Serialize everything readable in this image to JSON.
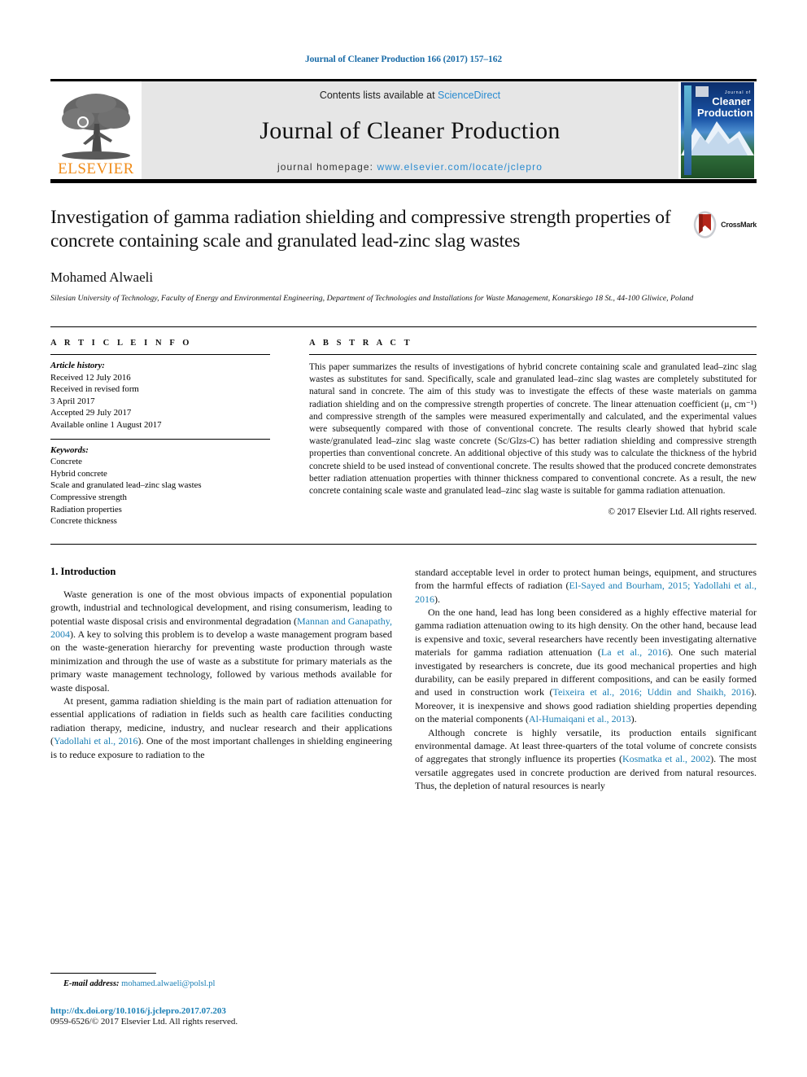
{
  "running_head": "Journal of Cleaner Production 166 (2017) 157–162",
  "masthead": {
    "publisher_name": "ELSEVIER",
    "contents_prefix": "Contents lists available at ",
    "contents_link": "ScienceDirect",
    "journal_name": "Journal of Cleaner Production",
    "homepage_prefix": "journal homepage: ",
    "homepage_url": "www.elsevier.com/locate/jclepro",
    "cover": {
      "line1": "Journal of",
      "line2": "Cleaner",
      "line3": "Production"
    }
  },
  "article": {
    "title": "Investigation of gamma radiation shielding and compressive strength properties of concrete containing scale and granulated lead-zinc slag wastes",
    "crossmark_label": "CrossMark",
    "author": "Mohamed Alwaeli",
    "affiliation": "Silesian University of Technology, Faculty of Energy and Environmental Engineering, Department of Technologies and Installations for Waste Management, Konarskiego 18 St., 44-100 Gliwice, Poland"
  },
  "article_info": {
    "heading": "A R T I C L E   I N F O",
    "history_label": "Article history:",
    "history_lines": [
      "Received 12 July 2016",
      "Received in revised form",
      "3 April 2017",
      "Accepted 29 July 2017",
      "Available online 1 August 2017"
    ],
    "keywords_label": "Keywords:",
    "keywords": [
      "Concrete",
      "Hybrid concrete",
      "Scale and granulated lead–zinc slag wastes",
      "Compressive strength",
      "Radiation properties",
      "Concrete thickness"
    ]
  },
  "abstract": {
    "heading": "A B S T R A C T",
    "text": "This paper summarizes the results of investigations of hybrid concrete containing scale and granulated lead–zinc slag wastes as substitutes for sand. Specifically, scale and granulated lead–zinc slag wastes are completely substituted for natural sand in concrete. The aim of this study was to investigate the effects of these waste materials on gamma radiation shielding and on the compressive strength properties of concrete. The linear attenuation coefficient (μ, cm⁻¹) and compressive strength of the samples were measured experimentally and calculated, and the experimental values were subsequently compared with those of conventional concrete. The results clearly showed that hybrid scale waste/granulated lead–zinc slag waste concrete (Sc/Glzs-C) has better radiation shielding and compressive strength properties than conventional concrete. An additional objective of this study was to calculate the thickness of the hybrid concrete shield to be used instead of conventional concrete. The results showed that the produced concrete demonstrates better radiation attenuation properties with thinner thickness compared to conventional concrete. As a result, the new concrete containing scale waste and granulated lead–zinc slag waste is suitable for gamma radiation attenuation.",
    "copyright": "© 2017 Elsevier Ltd. All rights reserved."
  },
  "body": {
    "section_title": "1. Introduction",
    "left_column": [
      {
        "segments": [
          {
            "t": "Waste generation is one of the most obvious impacts of exponential population growth, industrial and technological development, and rising consumerism, leading to potential waste disposal crisis and environmental degradation (",
            "c": false
          },
          {
            "t": "Mannan and Ganapathy, 2004",
            "c": true
          },
          {
            "t": "). A key to solving this problem is to develop a waste management program based on the waste-generation hierarchy for preventing waste production through waste minimization and through the use of waste as a substitute for primary materials as the primary waste management technology, followed by various methods available for waste disposal.",
            "c": false
          }
        ]
      },
      {
        "segments": [
          {
            "t": "At present, gamma radiation shielding is the main part of radiation attenuation for essential applications of radiation in fields such as health care facilities conducting radiation therapy, medicine, industry, and nuclear research and their applications (",
            "c": false
          },
          {
            "t": "Yadollahi et al., 2016",
            "c": true
          },
          {
            "t": "). One of the most important challenges in shielding engineering is to reduce exposure to radiation to the",
            "c": false
          }
        ]
      }
    ],
    "right_column": [
      {
        "segments": [
          {
            "t": "standard acceptable level in order to protect human beings, equipment, and structures from the harmful effects of radiation (",
            "c": false
          },
          {
            "t": "El-Sayed and Bourham, 2015; Yadollahi et al., 2016",
            "c": true
          },
          {
            "t": ").",
            "c": false
          }
        ],
        "noindent": true
      },
      {
        "segments": [
          {
            "t": "On the one hand, lead has long been considered as a highly effective material for gamma radiation attenuation owing to its high density. On the other hand, because lead is expensive and toxic, several researchers have recently been investigating alternative materials for gamma radiation attenuation (",
            "c": false
          },
          {
            "t": "La et al., 2016",
            "c": true
          },
          {
            "t": "). One such material investigated by researchers is concrete, due its good mechanical properties and high durability, can be easily prepared in different compositions, and can be easily formed and used in construction work (",
            "c": false
          },
          {
            "t": "Teixeira et al., 2016; Uddin and Shaikh, 2016",
            "c": true
          },
          {
            "t": "). Moreover, it is inexpensive and shows good radiation shielding properties depending on the material components (",
            "c": false
          },
          {
            "t": "Al-Humaiqani et al., 2013",
            "c": true
          },
          {
            "t": ").",
            "c": false
          }
        ]
      },
      {
        "segments": [
          {
            "t": "Although concrete is highly versatile, its production entails significant environmental damage. At least three-quarters of the total volume of concrete consists of aggregates that strongly influence its properties (",
            "c": false
          },
          {
            "t": "Kosmatka et al., 2002",
            "c": true
          },
          {
            "t": "). The most versatile aggregates used in concrete production are derived from natural resources. Thus, the depletion of natural resources is nearly",
            "c": false
          }
        ]
      }
    ]
  },
  "footer": {
    "email_label": "E-mail address:",
    "email": "mohamed.alwaeli@polsl.pl",
    "doi": "http://dx.doi.org/10.1016/j.jclepro.2017.07.203",
    "issn_line": "0959-6526/© 2017 Elsevier Ltd. All rights reserved."
  },
  "colors": {
    "link": "#1a7fb5",
    "header_blue": "#1a6ca8",
    "elsevier_orange": "#f08c1a",
    "masthead_gray": "#e6e6e6"
  }
}
